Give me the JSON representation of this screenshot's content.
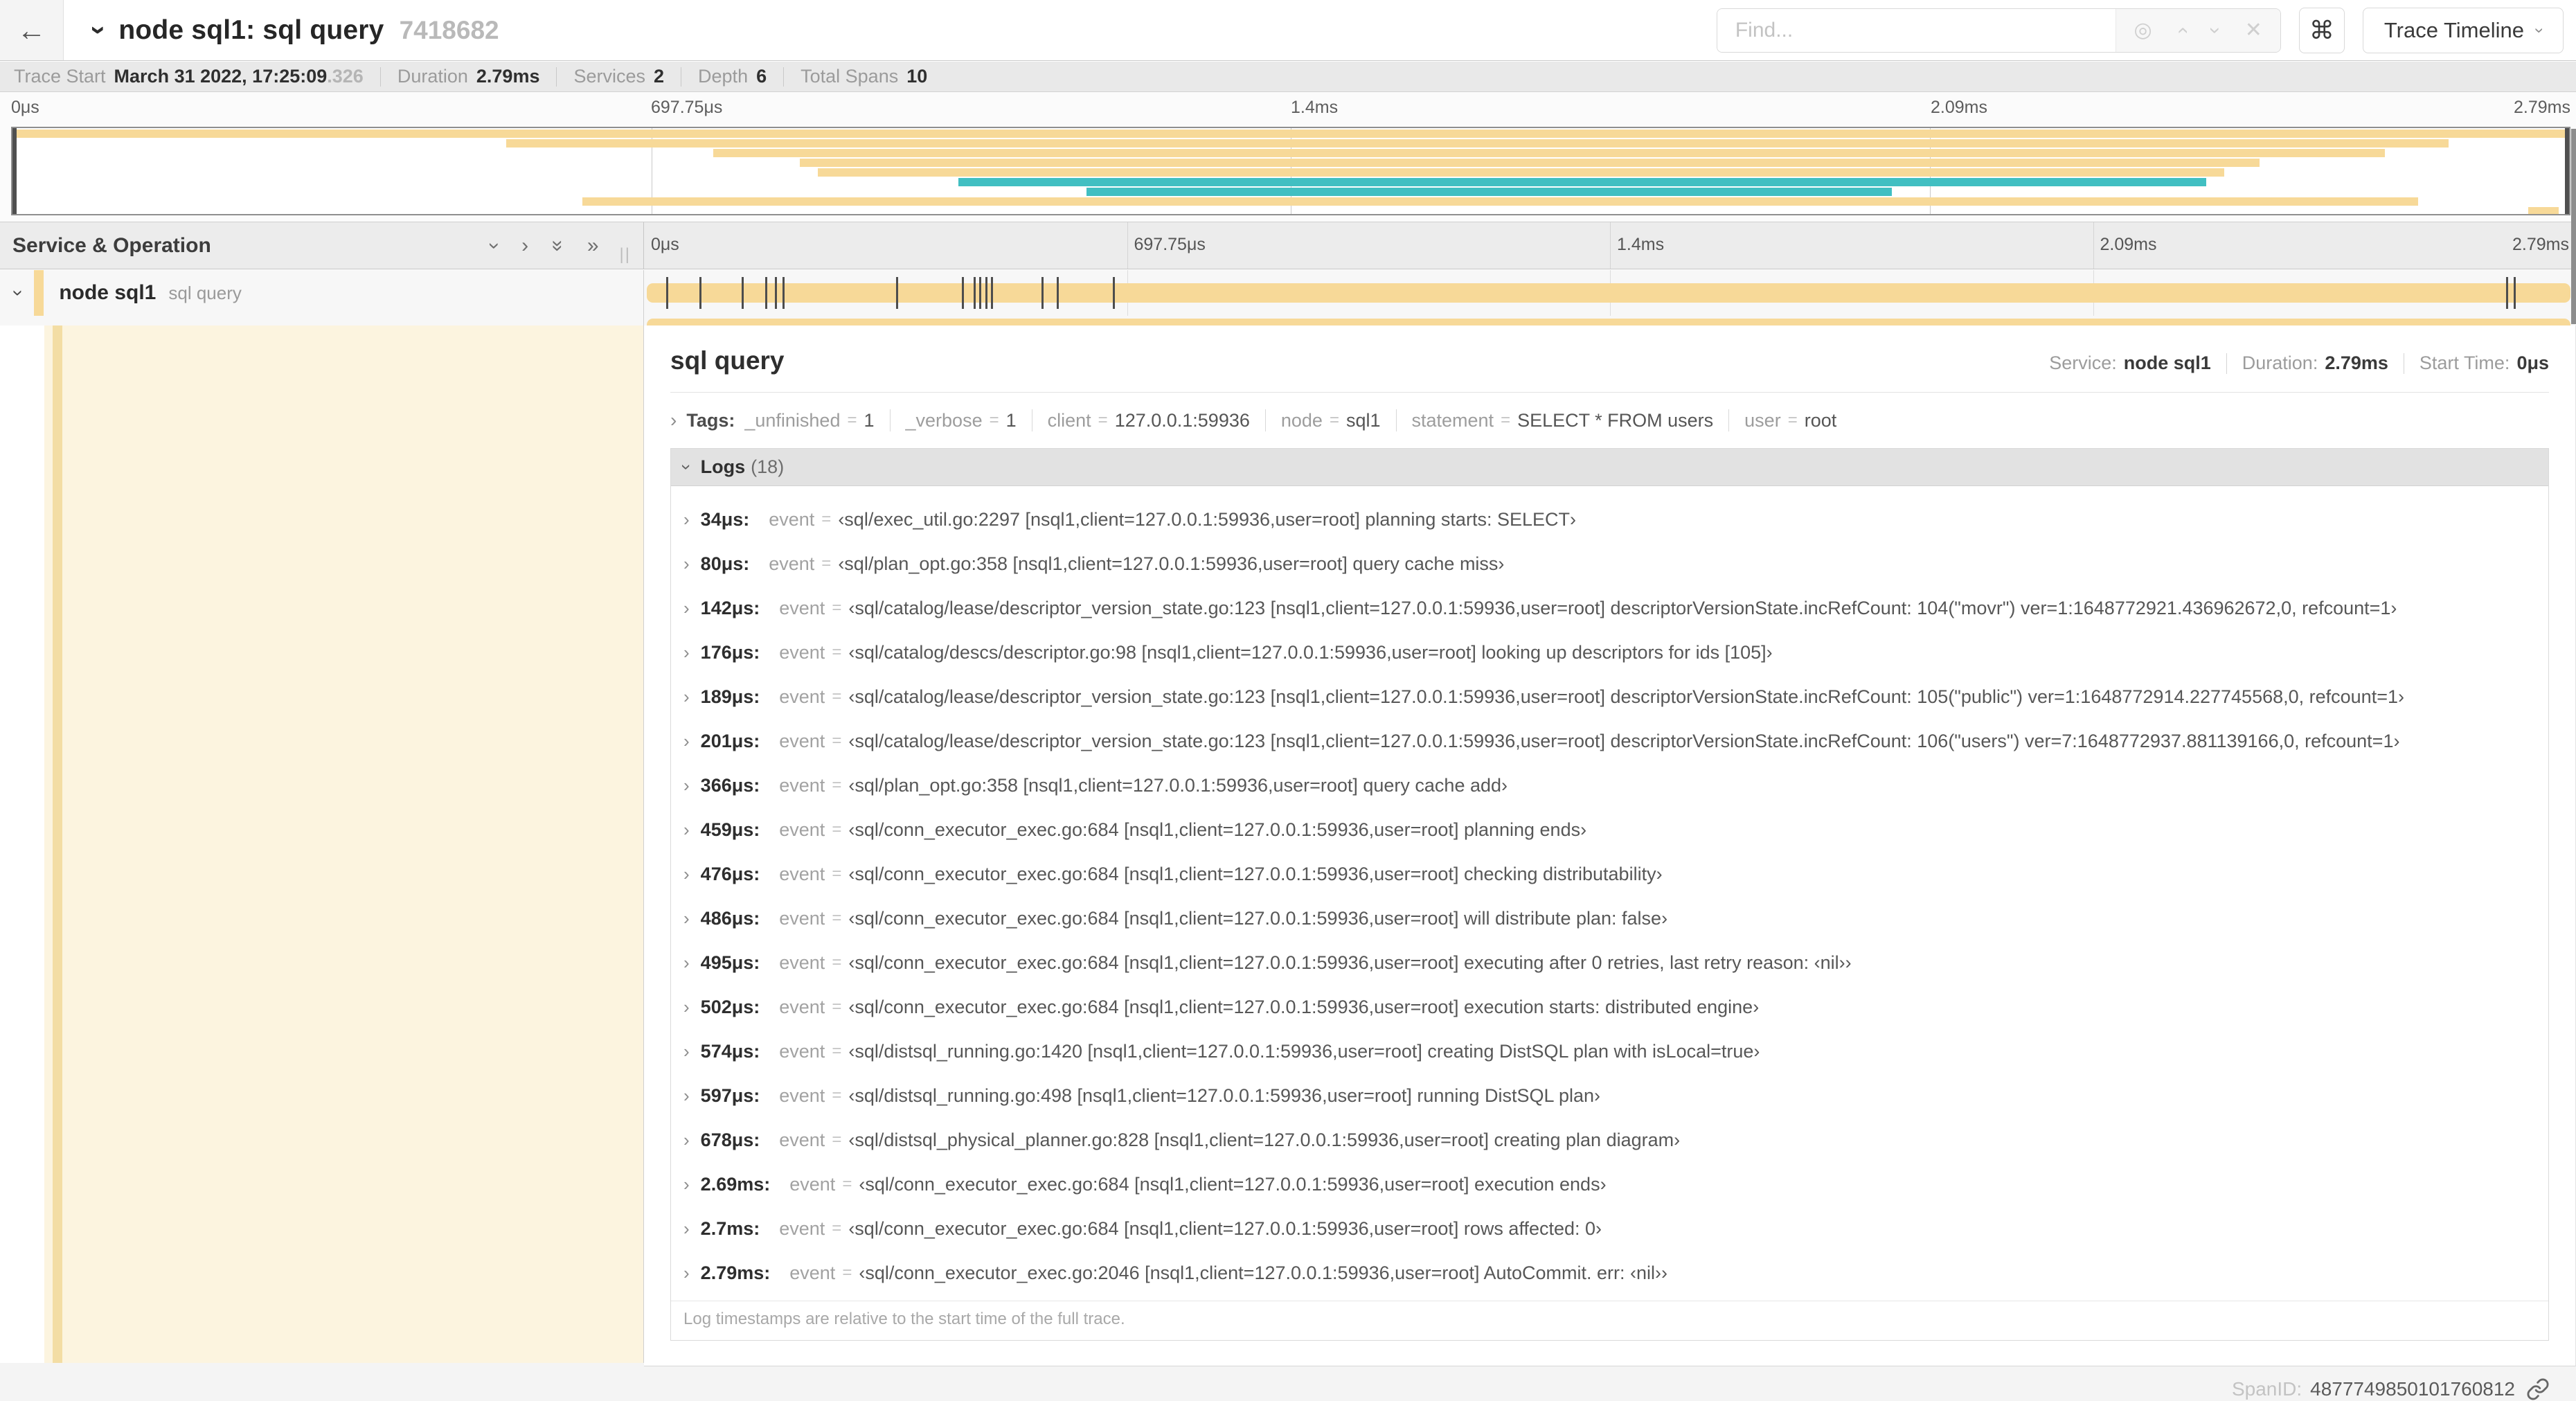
{
  "header": {
    "back_icon": "←",
    "collapse_icon": "›",
    "title": "node sql1: sql query",
    "trace_id": "7418682",
    "find_placeholder": "Find...",
    "find_icons": {
      "locate": "◎",
      "prev": "›",
      "next": "›",
      "clear": "✕"
    },
    "keyboard_icon": "⌘",
    "view_selector_label": "Trace Timeline",
    "view_selector_chevron": "›"
  },
  "trace_info": {
    "items": [
      {
        "label": "Trace Start",
        "value": "March 31 2022, 17:25:09",
        "suffix": ".326"
      },
      {
        "label": "Duration",
        "value": "2.79ms",
        "suffix": ""
      },
      {
        "label": "Services",
        "value": "2",
        "suffix": ""
      },
      {
        "label": "Depth",
        "value": "6",
        "suffix": ""
      },
      {
        "label": "Total Spans",
        "value": "10",
        "suffix": ""
      }
    ]
  },
  "colors": {
    "tan": "#f7d998",
    "teal": "#41bfc2",
    "cream": "#fcf4df",
    "accent_stripe": "#f3dda4"
  },
  "minimap": {
    "ticks": [
      "0μs",
      "697.75μs",
      "1.4ms",
      "2.09ms",
      "2.79ms"
    ],
    "rows": [
      {
        "left": 0,
        "width": 100,
        "color": "tan"
      },
      {
        "left": 19.3,
        "width": 76.0,
        "color": "tan"
      },
      {
        "left": 27.4,
        "width": 65.4,
        "color": "tan"
      },
      {
        "left": 30.8,
        "width": 57.1,
        "color": "tan"
      },
      {
        "left": 31.5,
        "width": 55.0,
        "color": "tan"
      },
      {
        "left": 37.0,
        "width": 48.8,
        "color": "teal"
      },
      {
        "left": 42.0,
        "width": 31.5,
        "color": "teal"
      },
      {
        "left": 22.3,
        "width": 71.8,
        "color": "tan"
      },
      {
        "left": 98.4,
        "width": 1.2,
        "color": "tan"
      }
    ]
  },
  "timeline_header": {
    "label": "Service & Operation",
    "icons": [
      "chevron-down",
      "chevron-right",
      "double-chevron-down",
      "double-chevron-right"
    ],
    "resizer": "||",
    "ticks": [
      "0μs",
      "697.75μs",
      "1.4ms",
      "2.09ms",
      "2.79ms"
    ]
  },
  "span_row": {
    "collapse_icon": "›",
    "service": "node sql1",
    "operation": "sql query",
    "log_marker_pcts": [
      1.2,
      2.9,
      5.1,
      6.3,
      6.8,
      7.2,
      13.1,
      16.5,
      17.1,
      17.4,
      17.7,
      18.0,
      20.6,
      21.4,
      24.3,
      96.4,
      96.8,
      99.8
    ]
  },
  "detail": {
    "operation": "sql query",
    "meta": [
      {
        "label": "Service:",
        "value": "node sql1"
      },
      {
        "label": "Duration:",
        "value": "2.79ms"
      },
      {
        "label": "Start Time:",
        "value": "0μs"
      }
    ],
    "tags_label": "Tags:",
    "tags": [
      {
        "key": "_unfinished",
        "value": "1"
      },
      {
        "key": "_verbose",
        "value": "1"
      },
      {
        "key": "client",
        "value": "127.0.0.1:59936"
      },
      {
        "key": "node",
        "value": "sql1"
      },
      {
        "key": "statement",
        "value": "SELECT * FROM users"
      },
      {
        "key": "user",
        "value": "root"
      }
    ],
    "logs": {
      "title": "Logs",
      "count": "(18)",
      "entries": [
        {
          "ts": "34μs:",
          "key": "event",
          "value": "‹sql/exec_util.go:2297 [nsql1,client=127.0.0.1:59936,user=root] planning starts: SELECT›"
        },
        {
          "ts": "80μs:",
          "key": "event",
          "value": "‹sql/plan_opt.go:358 [nsql1,client=127.0.0.1:59936,user=root] query cache miss›"
        },
        {
          "ts": "142μs:",
          "key": "event",
          "value": "‹sql/catalog/lease/descriptor_version_state.go:123 [nsql1,client=127.0.0.1:59936,user=root] descriptorVersionState.incRefCount: 104(\"movr\") ver=1:1648772921.436962672,0, refcount=1›"
        },
        {
          "ts": "176μs:",
          "key": "event",
          "value": "‹sql/catalog/descs/descriptor.go:98 [nsql1,client=127.0.0.1:59936,user=root] looking up descriptors for ids [105]›"
        },
        {
          "ts": "189μs:",
          "key": "event",
          "value": "‹sql/catalog/lease/descriptor_version_state.go:123 [nsql1,client=127.0.0.1:59936,user=root] descriptorVersionState.incRefCount: 105(\"public\") ver=1:1648772914.227745568,0, refcount=1›"
        },
        {
          "ts": "201μs:",
          "key": "event",
          "value": "‹sql/catalog/lease/descriptor_version_state.go:123 [nsql1,client=127.0.0.1:59936,user=root] descriptorVersionState.incRefCount: 106(\"users\") ver=7:1648772937.881139166,0, refcount=1›"
        },
        {
          "ts": "366μs:",
          "key": "event",
          "value": "‹sql/plan_opt.go:358 [nsql1,client=127.0.0.1:59936,user=root] query cache add›"
        },
        {
          "ts": "459μs:",
          "key": "event",
          "value": "‹sql/conn_executor_exec.go:684 [nsql1,client=127.0.0.1:59936,user=root] planning ends›"
        },
        {
          "ts": "476μs:",
          "key": "event",
          "value": "‹sql/conn_executor_exec.go:684 [nsql1,client=127.0.0.1:59936,user=root] checking distributability›"
        },
        {
          "ts": "486μs:",
          "key": "event",
          "value": "‹sql/conn_executor_exec.go:684 [nsql1,client=127.0.0.1:59936,user=root] will distribute plan: false›"
        },
        {
          "ts": "495μs:",
          "key": "event",
          "value": "‹sql/conn_executor_exec.go:684 [nsql1,client=127.0.0.1:59936,user=root] executing after 0 retries, last retry reason: ‹nil››"
        },
        {
          "ts": "502μs:",
          "key": "event",
          "value": "‹sql/conn_executor_exec.go:684 [nsql1,client=127.0.0.1:59936,user=root] execution starts: distributed engine›"
        },
        {
          "ts": "574μs:",
          "key": "event",
          "value": "‹sql/distsql_running.go:1420 [nsql1,client=127.0.0.1:59936,user=root] creating DistSQL plan with isLocal=true›"
        },
        {
          "ts": "597μs:",
          "key": "event",
          "value": "‹sql/distsql_running.go:498 [nsql1,client=127.0.0.1:59936,user=root] running DistSQL plan›"
        },
        {
          "ts": "678μs:",
          "key": "event",
          "value": "‹sql/distsql_physical_planner.go:828 [nsql1,client=127.0.0.1:59936,user=root] creating plan diagram›"
        },
        {
          "ts": "2.69ms:",
          "key": "event",
          "value": "‹sql/conn_executor_exec.go:684 [nsql1,client=127.0.0.1:59936,user=root] execution ends›"
        },
        {
          "ts": "2.7ms:",
          "key": "event",
          "value": "‹sql/conn_executor_exec.go:684 [nsql1,client=127.0.0.1:59936,user=root] rows affected: 0›"
        },
        {
          "ts": "2.79ms:",
          "key": "event",
          "value": "‹sql/conn_executor_exec.go:2046 [nsql1,client=127.0.0.1:59936,user=root] AutoCommit. err: ‹nil››"
        }
      ],
      "footer": "Log timestamps are relative to the start time of the full trace."
    },
    "span_id_label": "SpanID:",
    "span_id": "4877749850101760812"
  }
}
